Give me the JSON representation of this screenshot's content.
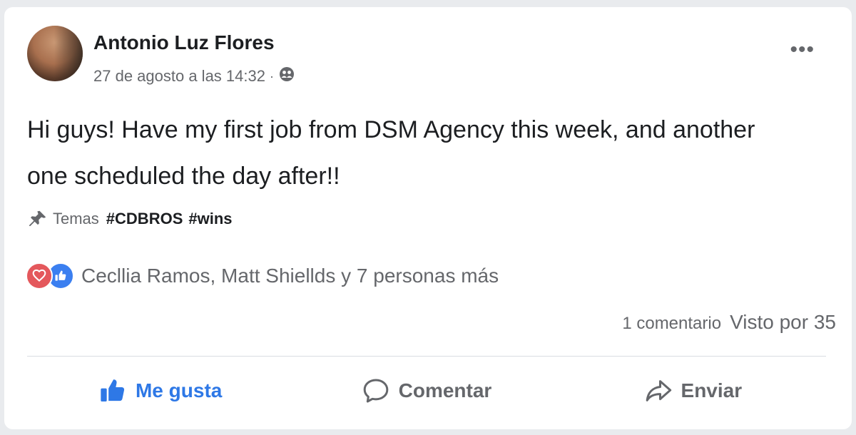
{
  "post": {
    "author": "Antonio Luz Flores",
    "timestamp": "27 de agosto a las 14:32",
    "separator": "·",
    "audience_icon": "friends-audience-icon",
    "more_label": "•••",
    "text": "Hi guys! Have my first job from DSM Agency this week, and another one scheduled the day after!!",
    "topics_label": "Temas",
    "hashtags": [
      "#CDBROS",
      "#wins"
    ]
  },
  "reactions": {
    "types": [
      "heart",
      "like"
    ],
    "summary": "Cecllia Ramos, Matt Shiellds y 7 personas más"
  },
  "stats": {
    "comments": "1 comentario",
    "views": "Visto por 35"
  },
  "actions": {
    "like": "Me gusta",
    "comment": "Comentar",
    "share": "Enviar"
  },
  "colors": {
    "like_active": "#2e78e6",
    "heart": "#e4585c",
    "like_reaction": "#3b7ff0",
    "secondary_text": "#65676b"
  }
}
